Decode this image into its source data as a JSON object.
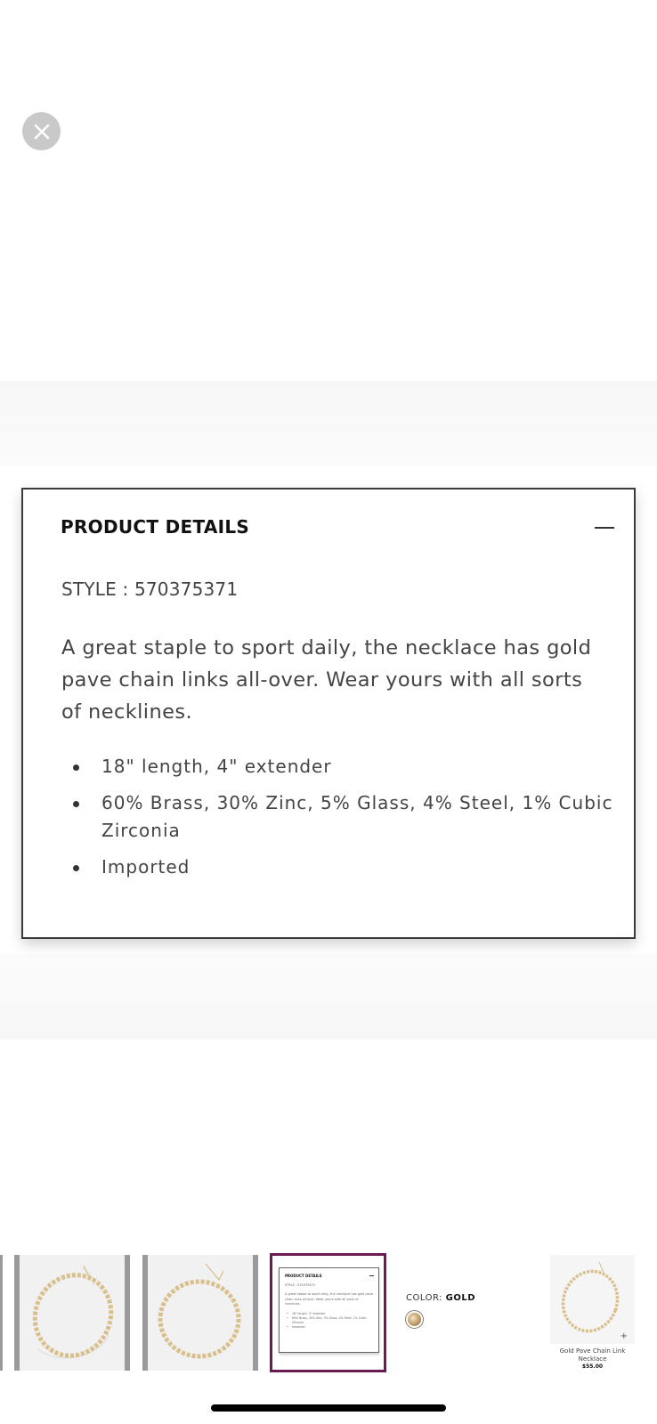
{
  "close_button": {
    "icon": "close-icon"
  },
  "product_details": {
    "title": "PRODUCT DETAILS",
    "style": "STYLE : 570375371",
    "description": "A great staple to sport daily, the necklace has gold pave chain links all-over. Wear yours with all sorts of necklines.",
    "bullets": [
      "18\" length, 4\" extender",
      "60% Brass, 30% Zinc, 5% Glass, 4% Steel, 1% Cubic Zirconia",
      "Imported"
    ]
  },
  "color": {
    "label": "COLOR: ",
    "value": "GOLD",
    "swatch_color": "#caa974"
  },
  "mini_product": {
    "name": "Gold Pave Chain Link Necklace",
    "price": "$55.00"
  },
  "colors": {
    "selected_border": "#6a1a55",
    "chain": "#d9bf8c"
  }
}
